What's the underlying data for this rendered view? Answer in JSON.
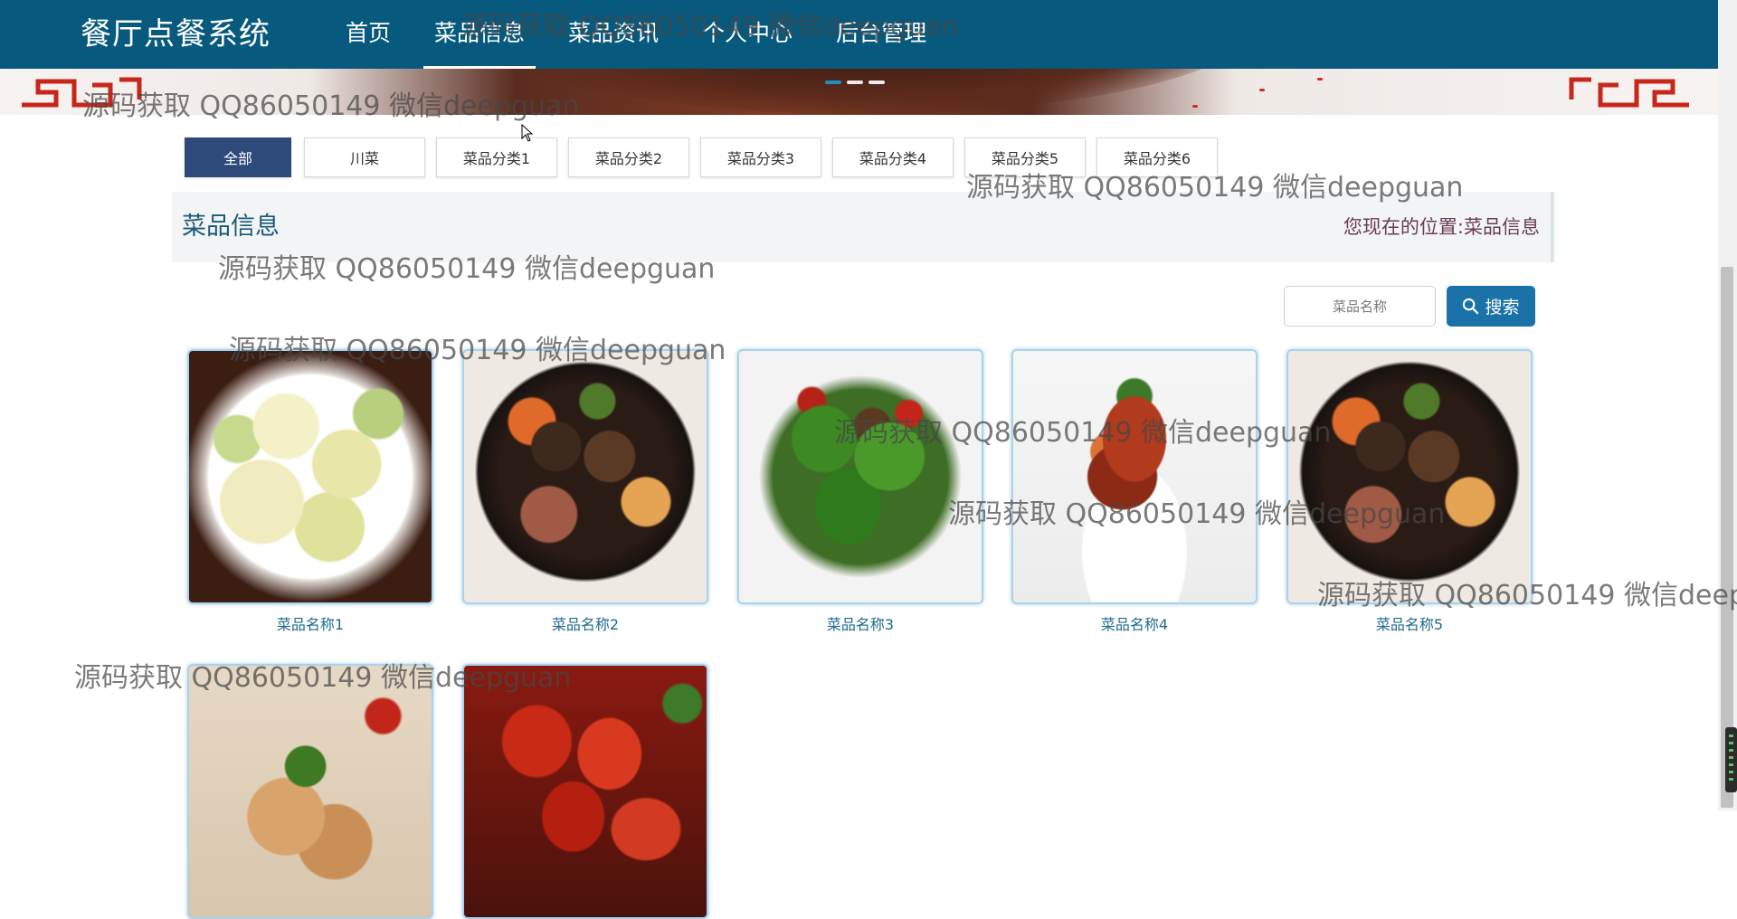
{
  "header": {
    "brand": "餐厅点餐系统",
    "nav": [
      {
        "label": "首页",
        "active": false
      },
      {
        "label": "菜品信息",
        "active": true
      },
      {
        "label": "菜品资讯",
        "active": false
      },
      {
        "label": "个人中心",
        "active": false
      },
      {
        "label": "后台管理",
        "active": false
      }
    ]
  },
  "banner": {
    "dots": 3,
    "active_dot": 0
  },
  "filters": [
    "全部",
    "川菜",
    "菜品分类1",
    "菜品分类2",
    "菜品分类3",
    "菜品分类4",
    "菜品分类5",
    "菜品分类6"
  ],
  "breadcrumb": {
    "title": "菜品信息",
    "location_label": "您现在的位置:",
    "location_value": "菜品信息"
  },
  "search": {
    "placeholder": "菜品名称",
    "button_label": "搜索"
  },
  "dishes": [
    {
      "name": "菜品名称1",
      "image": "cabbage"
    },
    {
      "name": "菜品名称2",
      "image": "pot"
    },
    {
      "name": "菜品名称3",
      "image": "beans"
    },
    {
      "name": "菜品名称4",
      "image": "chili"
    },
    {
      "name": "菜品名称5",
      "image": "pot"
    },
    {
      "name": "",
      "image": "noodle"
    },
    {
      "name": "",
      "image": "crayfish"
    }
  ],
  "watermark_text": "源码获取 QQ86050149 微信deepguan",
  "colors": {
    "navbar": "#075a7e",
    "active_filter": "#2d4a7a",
    "search_button": "#1b72a8",
    "dish_name": "#1d6a8c"
  }
}
